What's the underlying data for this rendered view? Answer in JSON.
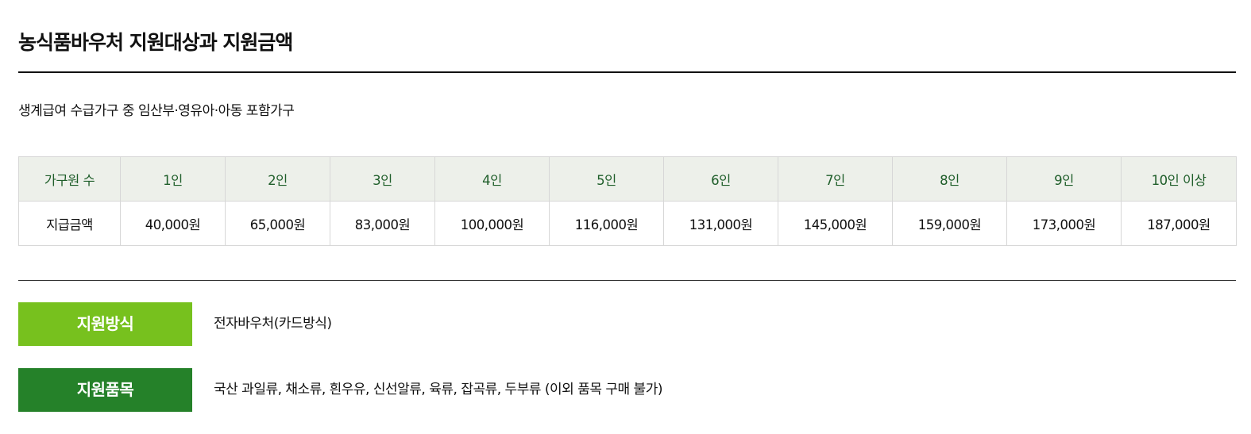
{
  "page": {
    "title": "농식품바우처 지원대상과 지원금액",
    "subtitle": "생계급여 수급가구 중 임산부·영유아·아동 포함가구"
  },
  "table": {
    "header_label": "가구원 수",
    "columns": [
      "1인",
      "2인",
      "3인",
      "4인",
      "5인",
      "6인",
      "7인",
      "8인",
      "9인",
      "10인 이상"
    ],
    "row_label": "지급금액",
    "values": [
      "40,000원",
      "65,000원",
      "83,000원",
      "100,000원",
      "116,000원",
      "131,000원",
      "145,000원",
      "159,000원",
      "173,000원",
      "187,000원"
    ]
  },
  "info": [
    {
      "label": "지원방식",
      "value": "전자바우처(카드방식)",
      "color": "#77c11e"
    },
    {
      "label": "지원품목",
      "value": "국산 과일류, 채소류, 흰우유, 신선알류, 육류, 잡곡류, 두부류 (이외 품목 구매 불가)",
      "color": "#258129"
    }
  ],
  "colors": {
    "header_bg": "#edf0ea",
    "header_text": "#1f5e2a",
    "border": "#d7d7d7"
  }
}
